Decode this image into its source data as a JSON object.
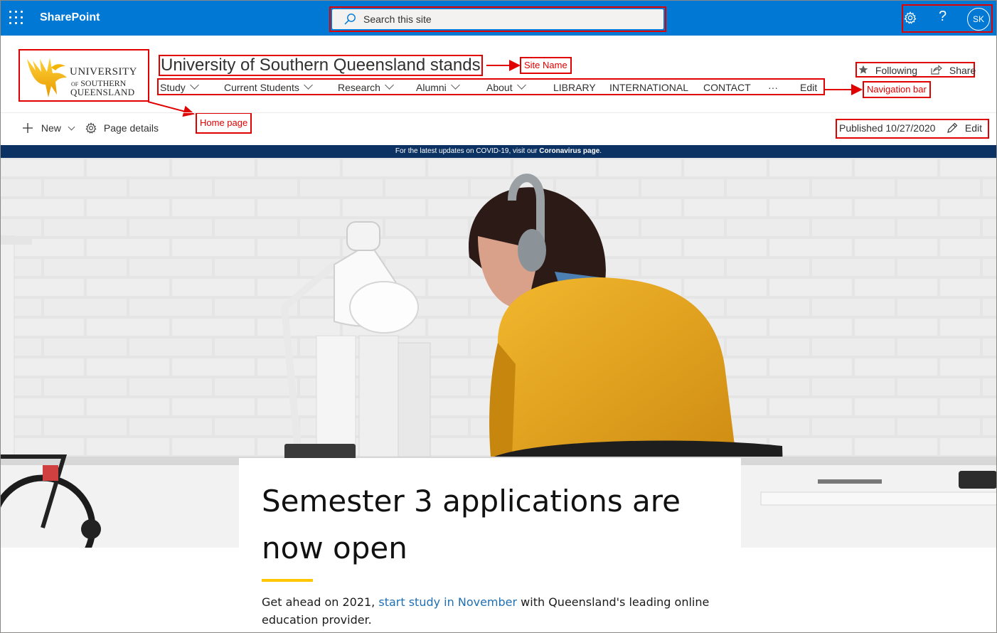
{
  "suite_bar": {
    "app_name": "SharePoint",
    "search_placeholder": "Search this site",
    "help_label": "?",
    "avatar_initials": "SK",
    "background_color": "#0078d4"
  },
  "logo": {
    "line1": "UNIVERSITY",
    "line2_of": "OF",
    "line2": "SOUTHERN",
    "line3": "QUEENSLAND"
  },
  "site": {
    "title": "University of Southern Queensland stands"
  },
  "nav": {
    "items": [
      {
        "label": "Study",
        "has_dropdown": true
      },
      {
        "label": "Current Students",
        "has_dropdown": true
      },
      {
        "label": "Research",
        "has_dropdown": true
      },
      {
        "label": "Alumni",
        "has_dropdown": true
      },
      {
        "label": "About",
        "has_dropdown": true
      },
      {
        "label": "LIBRARY",
        "has_dropdown": false
      },
      {
        "label": "INTERNATIONAL",
        "has_dropdown": false
      },
      {
        "label": "CONTACT",
        "has_dropdown": false
      },
      {
        "label": "···",
        "has_dropdown": false
      },
      {
        "label": "Edit",
        "has_dropdown": false
      }
    ]
  },
  "site_actions": {
    "following": "Following",
    "share": "Share"
  },
  "command_bar": {
    "new_label": "New",
    "page_details_label": "Page details",
    "published": "Published 10/27/2020",
    "edit_label": "Edit"
  },
  "annotations": {
    "site_name": "Site Name",
    "navigation_bar": "Navigation bar",
    "home_page": "Home page",
    "color": "#e00000"
  },
  "banner": {
    "text": "For the latest updates on COVID-19, visit our",
    "link": "Coronavirus page",
    "suffix": "."
  },
  "hero_card": {
    "title": "Semester 3 applications are now open",
    "body_before": "Get ahead on 2021,",
    "body_link": "start study in November",
    "body_after": "with Queensland's leading online education provider.",
    "accent_color": "#ffc600"
  }
}
